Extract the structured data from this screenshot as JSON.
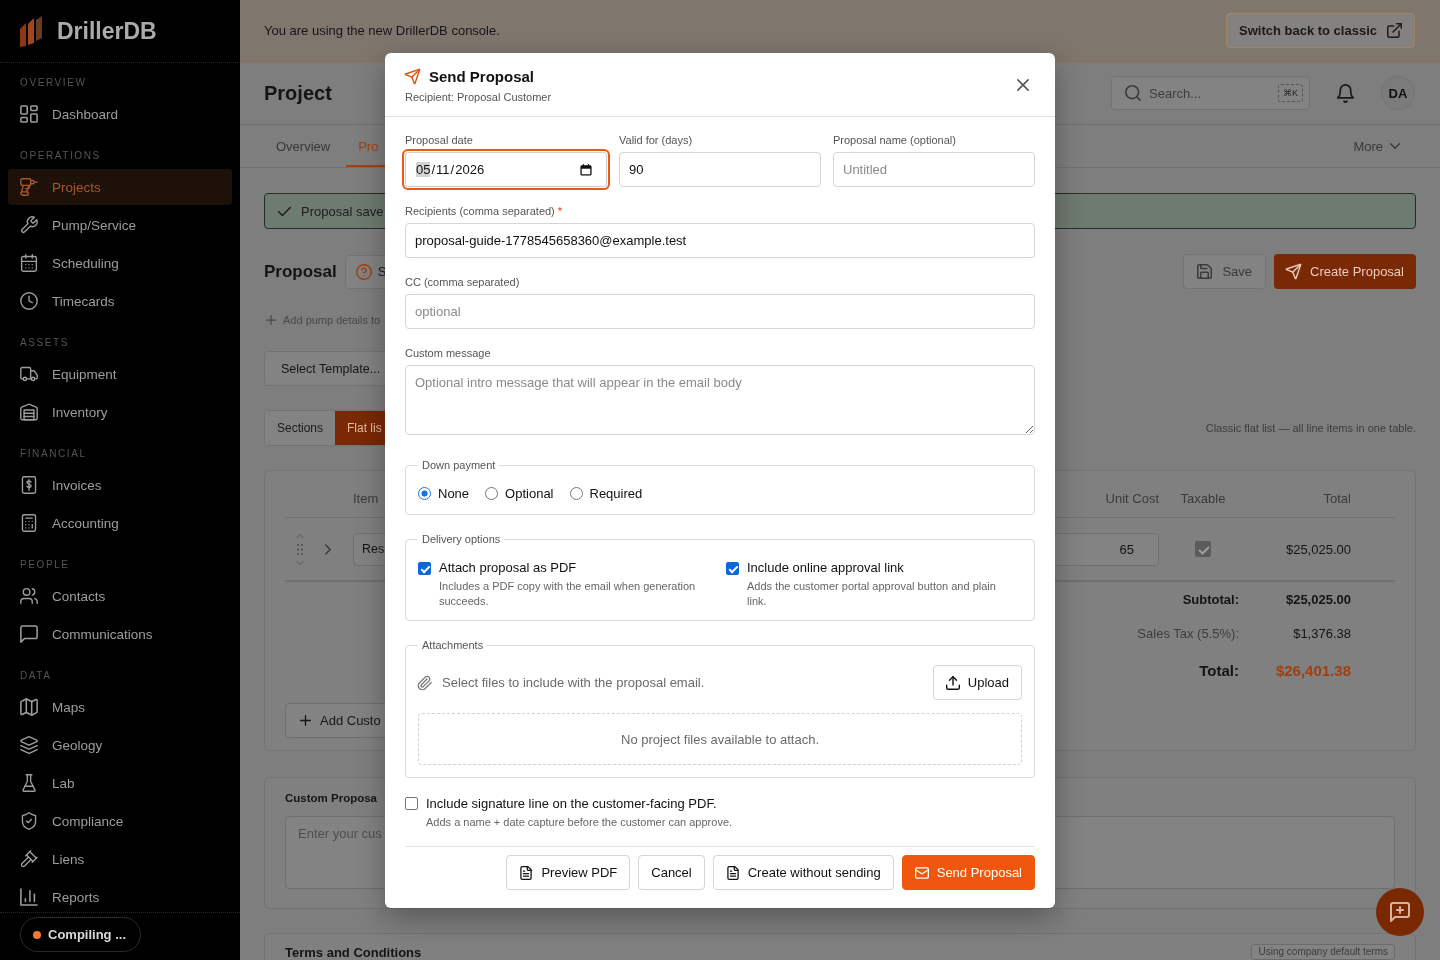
{
  "sidebar": {
    "logo": "DrillerDB",
    "sections": [
      {
        "heading": "OVERVIEW",
        "items": [
          {
            "label": "Dashboard",
            "selected": false
          }
        ]
      },
      {
        "heading": "OPERATIONS",
        "items": [
          {
            "label": "Projects",
            "selected": true
          },
          {
            "label": "Pump/Service",
            "selected": false
          },
          {
            "label": "Scheduling",
            "selected": false
          },
          {
            "label": "Timecards",
            "selected": false
          }
        ]
      },
      {
        "heading": "ASSETS",
        "items": [
          {
            "label": "Equipment",
            "selected": false
          },
          {
            "label": "Inventory",
            "selected": false
          }
        ]
      },
      {
        "heading": "FINANCIAL",
        "items": [
          {
            "label": "Invoices",
            "selected": false
          },
          {
            "label": "Accounting",
            "selected": false
          }
        ]
      },
      {
        "heading": "PEOPLE",
        "items": [
          {
            "label": "Contacts",
            "selected": false
          },
          {
            "label": "Communications",
            "selected": false
          }
        ]
      },
      {
        "heading": "DATA",
        "items": [
          {
            "label": "Maps",
            "selected": false
          },
          {
            "label": "Geology",
            "selected": false
          },
          {
            "label": "Lab",
            "selected": false
          },
          {
            "label": "Compliance",
            "selected": false
          },
          {
            "label": "Liens",
            "selected": false
          },
          {
            "label": "Reports",
            "selected": false
          }
        ]
      }
    ]
  },
  "dev_indicator": {
    "label": "Compiling ..."
  },
  "banner": {
    "message": "You are using the new DrillerDB console.",
    "button": "Switch back to classic"
  },
  "header": {
    "title": "Project",
    "search": {
      "placeholder": "Search...",
      "shortcut": "⌘K"
    },
    "avatar": "DA"
  },
  "tabs": [
    {
      "label": "Overview",
      "selected": false
    },
    {
      "label": "Pro",
      "selected": true
    }
  ],
  "more_menu": "More",
  "alert": {
    "message": "Proposal save"
  },
  "proposal_bar": {
    "title": "Proposal",
    "help_button": "S",
    "buttons": [
      {
        "label": "Save",
        "kind": "secondary"
      },
      {
        "label": "Create Proposal",
        "kind": "primary"
      }
    ]
  },
  "add_pump_link": "Add pump details to",
  "template_select": "Select Template...",
  "view_toggle": [
    {
      "label": "Sections",
      "selected": false
    },
    {
      "label": "Flat lis",
      "selected": true
    }
  ],
  "view_hint": "Classic flat list — all line items in one table.",
  "line_items": {
    "columns": [
      "Item",
      "Unit Cost",
      "Taxable",
      "Total"
    ],
    "rows": [
      {
        "item": "Res",
        "unit_cost": "65",
        "taxable": true,
        "total": "$25,025.00"
      }
    ],
    "totals": [
      {
        "kind": "subtotal",
        "label": "Subtotal:",
        "value": "$25,025.00"
      },
      {
        "kind": "tax",
        "label": "Sales Tax (5.5%):",
        "value": "$1,376.38"
      },
      {
        "kind": "grand",
        "label": "Total:",
        "value": "$26,401.38"
      }
    ],
    "add_button": "Add Custo"
  },
  "custom_card": {
    "title": "Custom Proposa",
    "placeholder": "Enter your cus"
  },
  "terms_card": {
    "title": "Terms and Conditions",
    "badge": "Using company default terms"
  },
  "modal": {
    "title": "Send Proposal",
    "subtitle": "Recipient: Proposal Customer",
    "fields": [
      {
        "kind": "date",
        "label": "Proposal date",
        "focused": true,
        "separator": "/",
        "segments": [
          {
            "text": "05",
            "selected": true
          },
          {
            "text": "11",
            "selected": false
          },
          {
            "text": "2026",
            "selected": false
          }
        ]
      },
      {
        "kind": "text",
        "label": "Valid for (days)",
        "focused": false,
        "value": "90"
      },
      {
        "kind": "text",
        "label": "Proposal name (optional)",
        "focused": false,
        "placeholder": "Untitled"
      }
    ],
    "recipients": {
      "label": "Recipients (comma separated)",
      "required_mark": "*",
      "value": "proposal-guide-1778545658360@example.test"
    },
    "cc": {
      "label": "CC (comma separated)",
      "placeholder": "optional"
    },
    "message": {
      "label": "Custom message",
      "placeholder": "Optional intro message that will appear in the email body"
    },
    "down_payment": {
      "legend": "Down payment",
      "options": [
        {
          "label": "None",
          "selected": true
        },
        {
          "label": "Optional",
          "selected": false
        },
        {
          "label": "Required",
          "selected": false
        }
      ]
    },
    "delivery": {
      "legend": "Delivery options",
      "options": [
        {
          "label": "Attach proposal as PDF",
          "description": "Includes a PDF copy with the email when generation succeeds.",
          "checked": true
        },
        {
          "label": "Include online approval link",
          "description": "Adds the customer portal approval button and plain link.",
          "checked": true
        }
      ]
    },
    "attachments": {
      "legend": "Attachments",
      "hint": "Select files to include with the proposal email.",
      "upload_button": "Upload",
      "empty_message": "No project files available to attach."
    },
    "signature": {
      "label": "Include signature line on the customer-facing PDF.",
      "description": "Adds a name + date capture before the customer can approve.",
      "checked": false
    },
    "buttons": [
      {
        "label": "Preview PDF",
        "kind": "preview"
      },
      {
        "label": "Cancel",
        "kind": "plain"
      },
      {
        "label": "Create without sending",
        "kind": "create"
      },
      {
        "label": "Send Proposal",
        "kind": "primary"
      }
    ]
  }
}
